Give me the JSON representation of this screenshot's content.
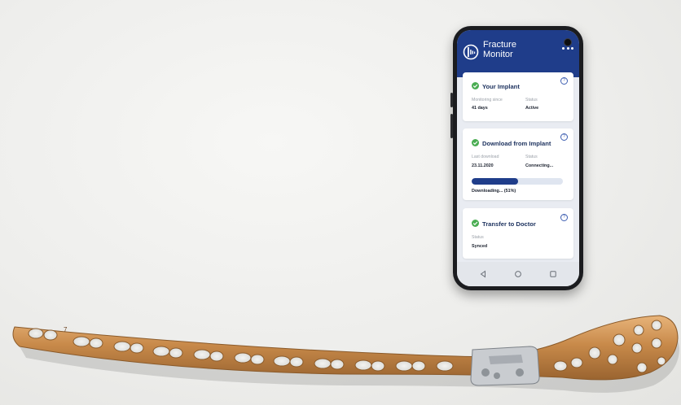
{
  "app": {
    "title_line1": "Fracture",
    "title_line2": "Monitor"
  },
  "cards": {
    "implant": {
      "title": "Your Implant",
      "monitoring_label": "Monitoring since",
      "monitoring_value": "41 days",
      "status_label": "Status",
      "status_value": "Active"
    },
    "download": {
      "title": "Download from Implant",
      "last_label": "Last download",
      "last_value": "23.11.2020",
      "status_label": "Status",
      "status_value": "Connecting...",
      "progress_text": "Downloading... (51%)",
      "progress": 0.51
    },
    "transfer": {
      "title": "Transfer to Doctor",
      "status_label": "Status",
      "status_value": "Synced"
    }
  },
  "help_glyph": "?",
  "plate_marking": "7",
  "icons": [
    "logo-icon",
    "menu-icon",
    "check-icon",
    "help-icon",
    "back-icon",
    "home-icon",
    "recents-icon"
  ],
  "colors": {
    "header": "#1f3d8a",
    "accent": "#1f3d8a",
    "check": "#4aad52",
    "plate": "#c88a4a"
  }
}
